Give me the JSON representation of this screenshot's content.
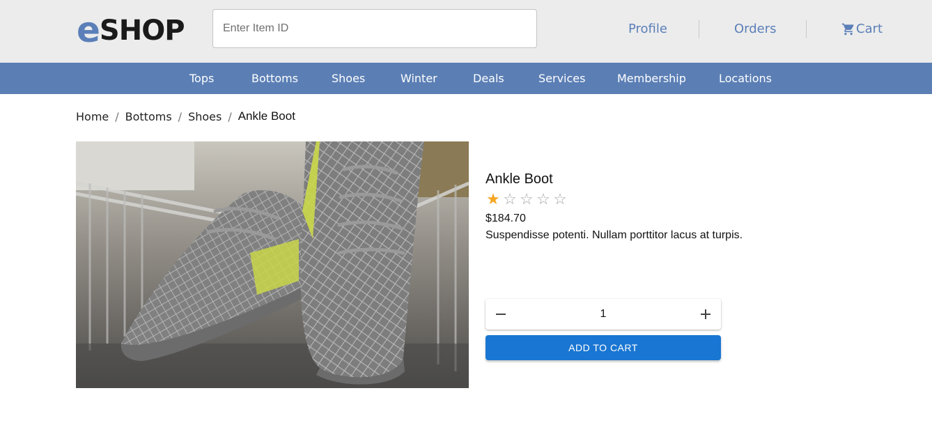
{
  "header": {
    "logo_e": "e",
    "logo_shop": "SHOP",
    "search_placeholder": "Enter Item ID",
    "links": {
      "profile": "Profile",
      "orders": "Orders",
      "cart": "Cart"
    }
  },
  "nav": {
    "items": [
      "Tops",
      "Bottoms",
      "Shoes",
      "Winter",
      "Deals",
      "Services",
      "Membership",
      "Locations"
    ]
  },
  "breadcrumb": {
    "items": [
      "Home",
      "Bottoms",
      "Shoes"
    ],
    "separator": "/",
    "current": "Ankle Boot"
  },
  "product": {
    "name": "Ankle Boot",
    "rating": 1,
    "rating_max": 5,
    "price": "$184.70",
    "description": "Suspendisse potenti. Nullam porttitor lacus at turpis.",
    "image_icon": "sneaker-photo",
    "quantity": "1",
    "add_to_cart_label": "ADD TO CART"
  },
  "colors": {
    "topbar_bg": "#ececec",
    "nav_bg": "#5b7fb5",
    "link": "#5b7fb8",
    "primary_button": "#1976d2",
    "star_filled": "#f5a623"
  }
}
